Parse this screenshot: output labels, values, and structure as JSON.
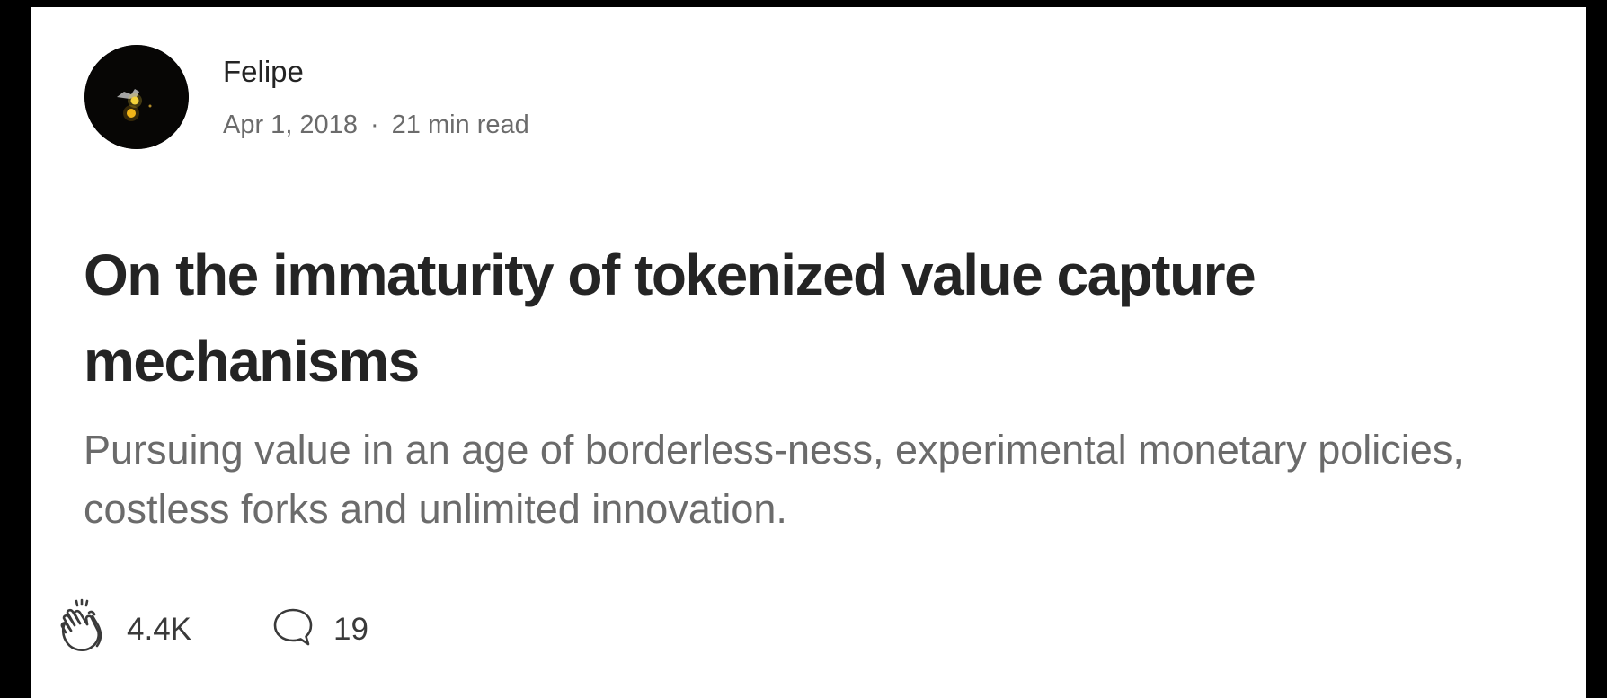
{
  "post": {
    "author": {
      "name": "Felipe",
      "avatar_icon": "author-avatar"
    },
    "date": "Apr 1, 2018",
    "separator": "·",
    "read_time": "21 min read",
    "title": "On the immaturity of tokenized value capture mechanisms",
    "subtitle": "Pursuing value in an age of borderless-ness, experimental monetary policies, costless forks and unlimited innovation.",
    "claps": {
      "icon": "clap-icon",
      "count": "4.4K"
    },
    "responses": {
      "icon": "comment-icon",
      "count": "19"
    }
  },
  "colors": {
    "background": "#000000",
    "card": "#ffffff",
    "title": "#242424",
    "muted": "#6b6b6b"
  }
}
